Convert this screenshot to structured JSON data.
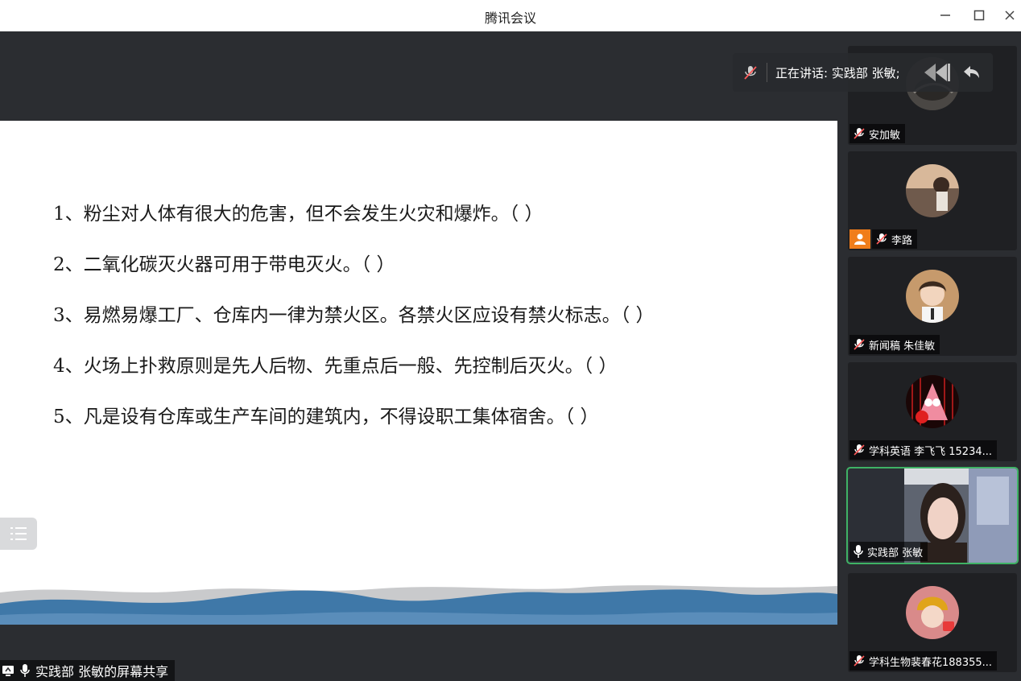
{
  "window": {
    "title": "腾讯会议"
  },
  "slide": {
    "questions": [
      "1、粉尘对人体有很大的危害，但不会发生火灾和爆炸。（  ）",
      "2、二氧化碳灭火器可用于带电灭火。（  ）",
      "3、易燃易爆工厂、仓库内一律为禁火区。各禁火区应设有禁火标志。（  ）",
      "4、火场上扑救原则是先人后物、先重点后一般、先控制后灭火。（  ）",
      "5、凡是设有仓库或生产车间的建筑内，不得设职工集体宿舍。（  ）"
    ]
  },
  "share": {
    "label": "实践部 张敏的屏幕共享"
  },
  "speaking": {
    "text": "正在讲话: 实践部 张敏;"
  },
  "participants": [
    {
      "name": "安加敏",
      "muted": true
    },
    {
      "name": "李路",
      "muted": true,
      "host": true
    },
    {
      "name": "新闻稿 朱佳敏",
      "muted": true
    },
    {
      "name": "学科英语 李飞飞 15234...",
      "muted": true
    },
    {
      "name": "实践部 张敏",
      "muted": false,
      "video": true
    },
    {
      "name": "学科生物裴春花188355...",
      "muted": true
    }
  ],
  "colors": {
    "accent_green": "#3fb265",
    "host_orange": "#f07d1a",
    "wave_blue": "#3f78a8"
  }
}
